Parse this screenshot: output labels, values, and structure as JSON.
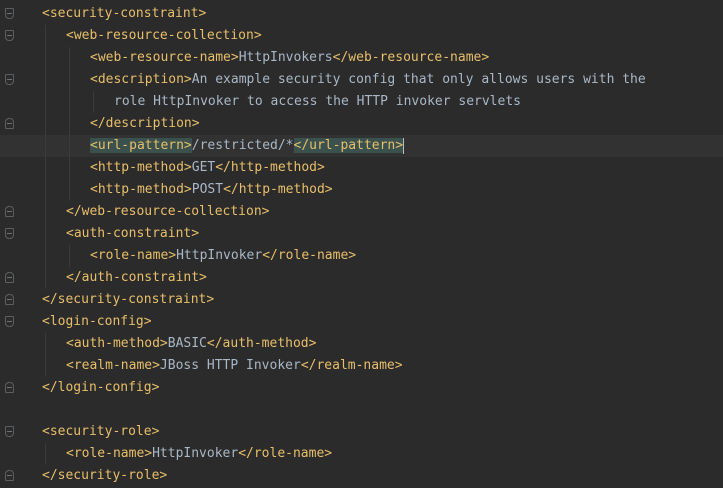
{
  "editor": {
    "colors": {
      "background": "#2b2b2b",
      "tag": "#e8bf6a",
      "text": "#a9b7c6",
      "highlight": "#3b514d",
      "current_line": "#323232"
    },
    "lines": [
      {
        "indent": 0,
        "fold": "open",
        "tokens": [
          {
            "k": "t",
            "v": "<security-constraint>"
          }
        ]
      },
      {
        "indent": 1,
        "fold": "open",
        "tokens": [
          {
            "k": "t",
            "v": "<web-resource-collection>"
          }
        ]
      },
      {
        "indent": 2,
        "fold": "",
        "tokens": [
          {
            "k": "t",
            "v": "<web-resource-name>"
          },
          {
            "k": "x",
            "v": "HttpInvokers"
          },
          {
            "k": "t",
            "v": "</web-resource-name>"
          }
        ]
      },
      {
        "indent": 2,
        "fold": "open",
        "tokens": [
          {
            "k": "t",
            "v": "<description>"
          },
          {
            "k": "x",
            "v": "An example security config that only allows users with the"
          }
        ]
      },
      {
        "indent": 3,
        "fold": "",
        "tokens": [
          {
            "k": "x",
            "v": "role HttpInvoker to access the HTTP invoker servlets"
          }
        ]
      },
      {
        "indent": 2,
        "fold": "close",
        "tokens": [
          {
            "k": "t",
            "v": "</description>"
          }
        ]
      },
      {
        "indent": 2,
        "fold": "",
        "current": true,
        "bulb": true,
        "caret": true,
        "tokens": [
          {
            "k": "t",
            "v": "<url-pattern>",
            "hl": true
          },
          {
            "k": "x",
            "v": "/restricted/*"
          },
          {
            "k": "t",
            "v": "</url-pattern>",
            "hl": true
          }
        ]
      },
      {
        "indent": 2,
        "fold": "",
        "tokens": [
          {
            "k": "t",
            "v": "<http-method>"
          },
          {
            "k": "x",
            "v": "GET"
          },
          {
            "k": "t",
            "v": "</http-method>"
          }
        ]
      },
      {
        "indent": 2,
        "fold": "",
        "tokens": [
          {
            "k": "t",
            "v": "<http-method>"
          },
          {
            "k": "x",
            "v": "POST"
          },
          {
            "k": "t",
            "v": "</http-method>"
          }
        ]
      },
      {
        "indent": 1,
        "fold": "close",
        "tokens": [
          {
            "k": "t",
            "v": "</web-resource-collection>"
          }
        ]
      },
      {
        "indent": 1,
        "fold": "open",
        "tokens": [
          {
            "k": "t",
            "v": "<auth-constraint>"
          }
        ]
      },
      {
        "indent": 2,
        "fold": "",
        "tokens": [
          {
            "k": "t",
            "v": "<role-name>"
          },
          {
            "k": "x",
            "v": "HttpInvoker"
          },
          {
            "k": "t",
            "v": "</role-name>"
          }
        ]
      },
      {
        "indent": 1,
        "fold": "close",
        "tokens": [
          {
            "k": "t",
            "v": "</auth-constraint>"
          }
        ]
      },
      {
        "indent": 0,
        "fold": "close",
        "tokens": [
          {
            "k": "t",
            "v": "</security-constraint>"
          }
        ]
      },
      {
        "indent": 0,
        "fold": "open",
        "tokens": [
          {
            "k": "t",
            "v": "<login-config>"
          }
        ]
      },
      {
        "indent": 1,
        "fold": "",
        "tokens": [
          {
            "k": "t",
            "v": "<auth-method>"
          },
          {
            "k": "x",
            "v": "BASIC"
          },
          {
            "k": "t",
            "v": "</auth-method>"
          }
        ]
      },
      {
        "indent": 1,
        "fold": "",
        "tokens": [
          {
            "k": "t",
            "v": "<realm-name>"
          },
          {
            "k": "x",
            "v": "JBoss HTTP Invoker"
          },
          {
            "k": "t",
            "v": "</realm-name>"
          }
        ]
      },
      {
        "indent": 0,
        "fold": "close",
        "tokens": [
          {
            "k": "t",
            "v": "</login-config>"
          }
        ]
      },
      {
        "indent": 0,
        "fold": "",
        "tokens": []
      },
      {
        "indent": 0,
        "fold": "open",
        "tokens": [
          {
            "k": "t",
            "v": "<security-role>"
          }
        ]
      },
      {
        "indent": 1,
        "fold": "",
        "tokens": [
          {
            "k": "t",
            "v": "<role-name>"
          },
          {
            "k": "x",
            "v": "HttpInvoker"
          },
          {
            "k": "t",
            "v": "</role-name>"
          }
        ]
      },
      {
        "indent": 0,
        "fold": "close",
        "tokens": [
          {
            "k": "t",
            "v": "</security-role>"
          }
        ]
      }
    ]
  }
}
